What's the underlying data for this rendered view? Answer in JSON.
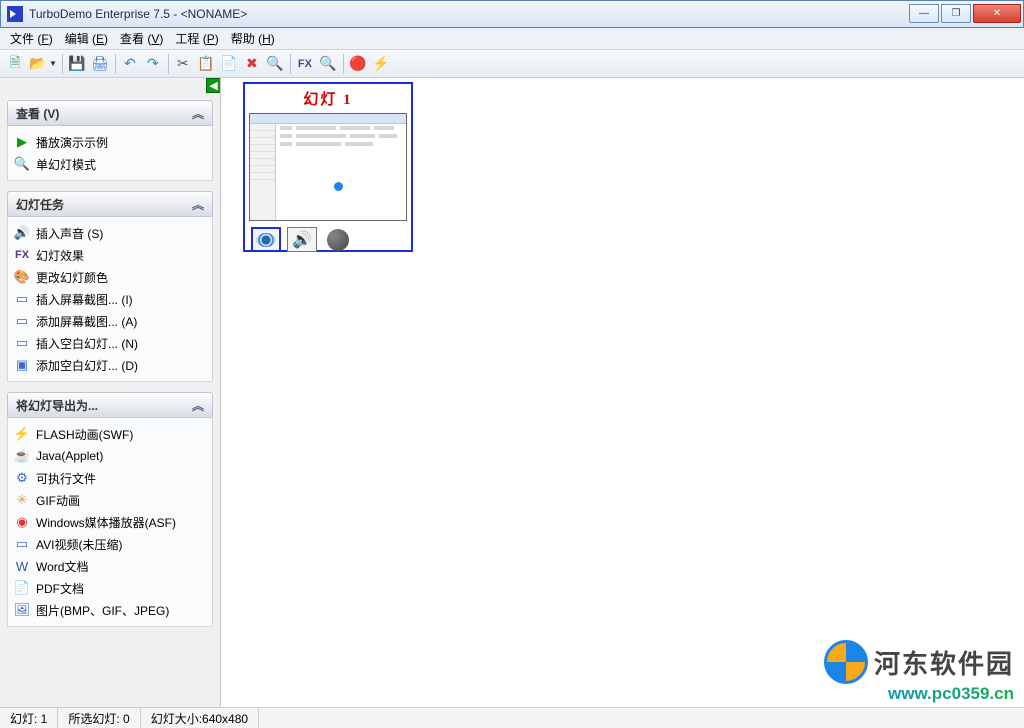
{
  "titlebar": {
    "text": "TurboDemo Enterprise 7.5 -  <NONAME>"
  },
  "window_buttons": {
    "min": "—",
    "max": "❐",
    "close": "✕"
  },
  "menu": [
    {
      "label": "文件",
      "key": "F"
    },
    {
      "label": "编辑",
      "key": "E"
    },
    {
      "label": "查看",
      "key": "V"
    },
    {
      "label": "工程",
      "key": "P"
    },
    {
      "label": "帮助",
      "key": "H"
    }
  ],
  "sidebar_tab_arrow": "◀",
  "panels": {
    "view": {
      "title": "查看 (V)",
      "items": [
        {
          "icon": "▶",
          "label": "播放演示示例",
          "color": "#0a9b0a"
        },
        {
          "icon": "🔍",
          "label": "单幻灯模式",
          "color": "#d9a23a"
        }
      ]
    },
    "tasks": {
      "title": "幻灯任务",
      "items": [
        {
          "icon": "🔊",
          "label": "插入声音 (S)",
          "color": "#3a6bd1"
        },
        {
          "icon": "FX",
          "label": "幻灯效果",
          "color": "#5b3a8a",
          "fx": true
        },
        {
          "icon": "🎨",
          "label": "更改幻灯颜色",
          "color": "#3a6bd1"
        },
        {
          "icon": "▭",
          "label": "插入屏幕截图... (I)",
          "color": "#3a6bd1"
        },
        {
          "icon": "▭",
          "label": "添加屏幕截图... (A)",
          "color": "#3a6bd1"
        },
        {
          "icon": "▭",
          "label": "插入空白幻灯... (N)",
          "color": "#3a6bd1"
        },
        {
          "icon": "▣",
          "label": "添加空白幻灯... (D)",
          "color": "#3a6bd1"
        }
      ]
    },
    "export": {
      "title": "将幻灯导出为...",
      "items": [
        {
          "icon": "⚡",
          "label": "FLASH动画(SWF)",
          "color": "#d33"
        },
        {
          "icon": "☕",
          "label": "Java(Applet)",
          "color": "#8a5a2a"
        },
        {
          "icon": "⚙",
          "label": "可执行文件",
          "color": "#3a6bd1"
        },
        {
          "icon": "✳",
          "label": "GIF动画",
          "color": "#d9a23a"
        },
        {
          "icon": "◉",
          "label": "Windows媒体播放器(ASF)",
          "color": "#d33"
        },
        {
          "icon": "▭",
          "label": "AVI视频(未压缩)",
          "color": "#3a6bd1"
        },
        {
          "icon": "W",
          "label": "Word文档",
          "color": "#2b579a"
        },
        {
          "icon": "📄",
          "label": "PDF文档",
          "color": "#c33"
        },
        {
          "icon": "🖼",
          "label": "图片(BMP、GIF、JPEG)",
          "color": "#3a6bd1"
        }
      ]
    }
  },
  "slide": {
    "title": "幻灯 1"
  },
  "status": {
    "slides": "幻灯: 1",
    "selected": "所选幻灯: 0",
    "size": "幻灯大小:640x480"
  },
  "watermark": {
    "brand": "河东软件园",
    "url": "www.pc0359.cn"
  },
  "chevron": "︽"
}
